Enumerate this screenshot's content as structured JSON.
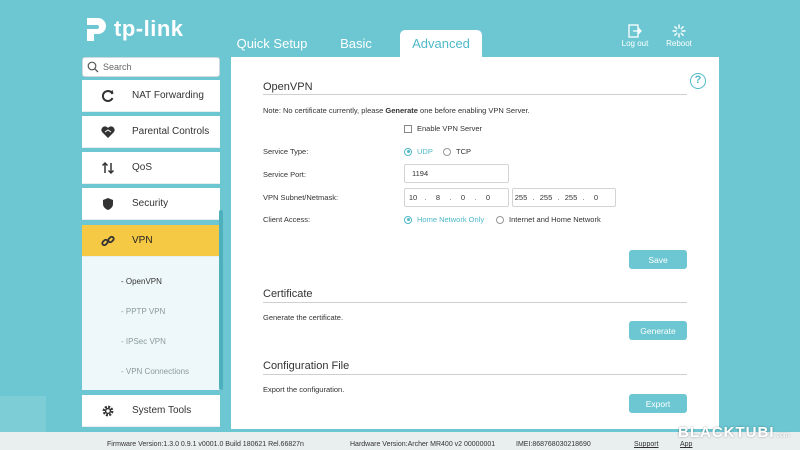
{
  "brand": {
    "name": "tp-link"
  },
  "tabs": [
    {
      "label": "Quick Setup",
      "active": false
    },
    {
      "label": "Basic",
      "active": false
    },
    {
      "label": "Advanced",
      "active": true
    }
  ],
  "header_actions": {
    "logout": "Log out",
    "reboot": "Reboot"
  },
  "search": {
    "placeholder": "Search"
  },
  "sidebar": {
    "items": [
      {
        "label": "NAT Forwarding",
        "icon": "nat-forwarding-icon"
      },
      {
        "label": "Parental Controls",
        "icon": "parental-controls-icon"
      },
      {
        "label": "QoS",
        "icon": "qos-icon"
      },
      {
        "label": "Security",
        "icon": "shield-icon"
      },
      {
        "label": "VPN",
        "icon": "vpn-link-icon",
        "active": true
      },
      {
        "label": "System Tools",
        "icon": "gear-icon"
      }
    ],
    "vpn_submenu": [
      {
        "label": "- OpenVPN",
        "active": true
      },
      {
        "label": "- PPTP VPN"
      },
      {
        "label": "- IPSec VPN"
      },
      {
        "label": "- VPN Connections"
      }
    ]
  },
  "openvpn": {
    "title": "OpenVPN",
    "note_prefix": "Note: No certificate currently, please ",
    "note_bold": "Generate",
    "note_suffix": " one before enabling VPN Server.",
    "enable_label": "Enable VPN Server",
    "enable_checked": false,
    "service_type_label": "Service Type:",
    "service_type_options": [
      "UDP",
      "TCP"
    ],
    "service_type_selected": "UDP",
    "service_port_label": "Service Port:",
    "service_port_value": "1194",
    "subnet_label": "VPN Subnet/Netmask:",
    "subnet": [
      "10",
      "8",
      "0",
      "0"
    ],
    "netmask": [
      "255",
      "255",
      "255",
      "0"
    ],
    "client_access_label": "Client Access:",
    "client_access_options": [
      "Home Network Only",
      "Internet and Home Network"
    ],
    "client_access_selected": "Home Network Only",
    "save_label": "Save"
  },
  "certificate": {
    "title": "Certificate",
    "desc": "Generate the certificate.",
    "button_label": "Generate"
  },
  "config_file": {
    "title": "Configuration File",
    "desc": "Export the configuration.",
    "button_label": "Export"
  },
  "footer": {
    "firmware": "Firmware Version:1.3.0 0.9.1 v0001.0 Build 180621 Rel.66827n",
    "hardware": "Hardware Version:Archer MR400 v2 00000001",
    "imei": "IMEI:868768030218690",
    "support": "Support",
    "app": "App"
  },
  "watermark": {
    "text": "BLACKTUBI",
    "suffix": ".com"
  },
  "colors": {
    "accent": "#6cc7d2",
    "active_menu": "#f6c944",
    "link": "#4fb9c9"
  }
}
